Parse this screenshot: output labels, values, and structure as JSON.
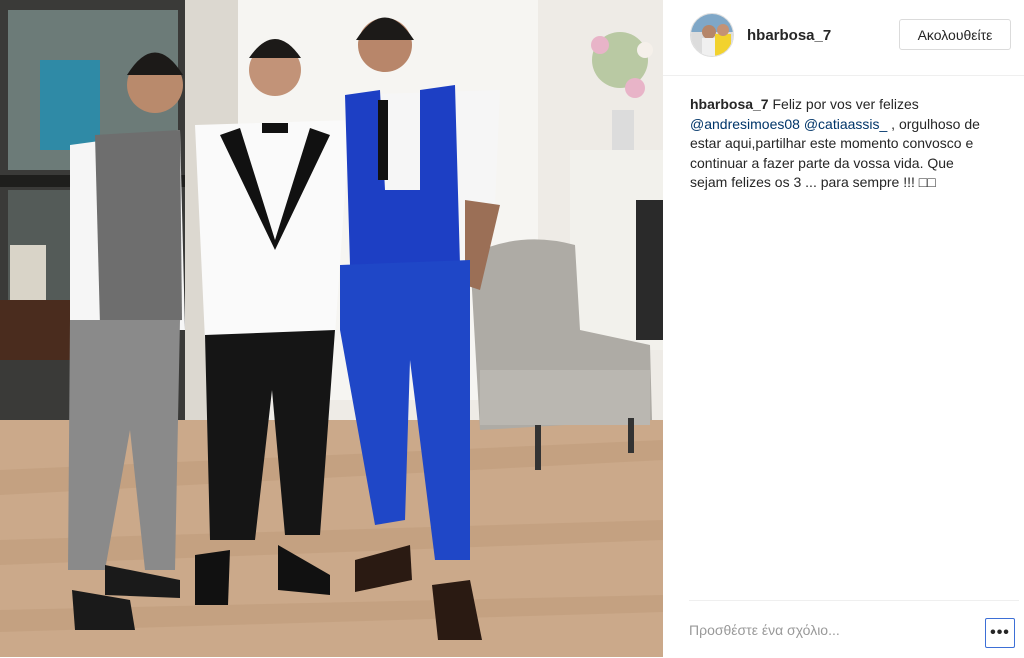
{
  "post": {
    "username": "hbarbosa_7",
    "follow_label": "Ακολουθείτε",
    "caption_user": "hbarbosa_7",
    "caption_part1": " Feliz por vos ver felizes ",
    "mention1": "@andresimoes08",
    "caption_part2": " ",
    "mention2": "@catiaassis_",
    "caption_part3": " , orgulhoso de estar aqui,partilhar este momento convosco e continuar a fazer parte da vossa vida. Que sejam felizes os 3 ... para sempre !!! □□",
    "comment_placeholder": "Προσθέστε ένα σχόλιο...",
    "more_label": "•••"
  },
  "icons": {
    "more": "more-options-icon",
    "avatar": "profile-avatar"
  },
  "colors": {
    "mention": "#003569",
    "text": "#262626",
    "placeholder": "#999999",
    "border": "#dbdbdb"
  }
}
